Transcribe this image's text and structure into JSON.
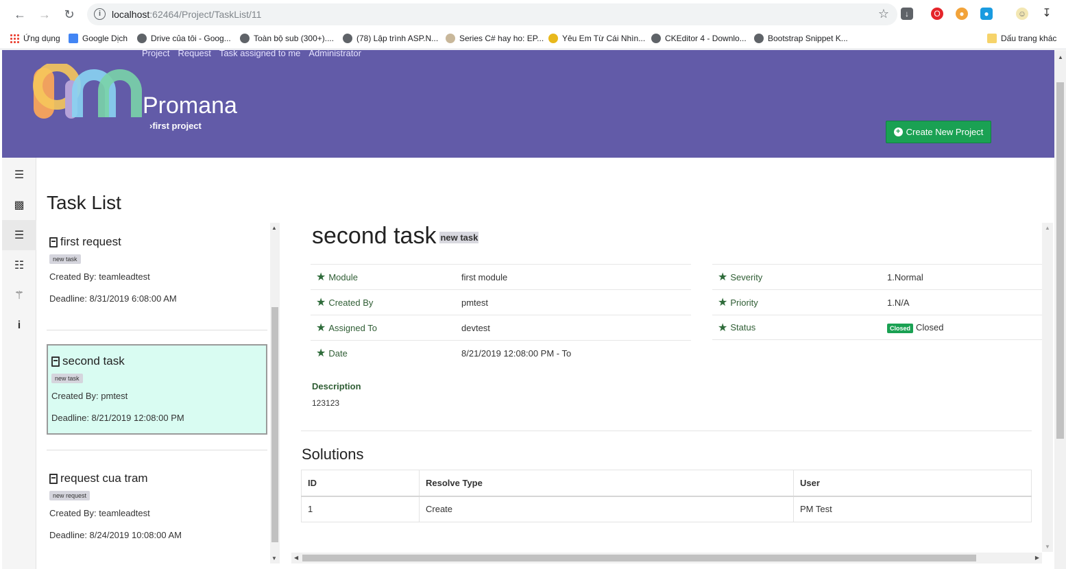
{
  "browser": {
    "url_host": "localhost",
    "url_path": ":62464/Project/TaskList/11",
    "bookmarks": [
      "Ứng dụng",
      "Google Dịch",
      "Drive của tôi - Goog...",
      "Toàn bộ sub (300+)....",
      "(78) Lập trình ASP.N...",
      "Series C# hay ho: EP...",
      "Yêu Em Từ Cái Nhìn...",
      "CKEditor 4 - Downlo...",
      "Bootstrap Snippet K...",
      "Dấu trang khác"
    ]
  },
  "header": {
    "nav": [
      "Project",
      "Request",
      "Task assigned to me",
      "Administrator"
    ],
    "brand": "Promana",
    "breadcrumb": "first project",
    "create_button": "Create New Project",
    "colors": {
      "header_bg": "#625ba8",
      "create_btn": "#1aa153"
    }
  },
  "sidebar": {
    "icons": [
      "menu-icon",
      "area-chart-icon",
      "task-list-icon",
      "cable-car-icon",
      "sitemap-icon",
      "info-icon"
    ]
  },
  "page": {
    "title": "Task List"
  },
  "task_list": [
    {
      "title": "first request",
      "badge": "new task",
      "created_by": "Created By: teamleadtest",
      "deadline": "Deadline: 8/31/2019 6:08:00 AM",
      "selected": false
    },
    {
      "title": "second task",
      "badge": "new task",
      "created_by": "Created By: pmtest",
      "deadline": "Deadline: 8/21/2019 12:08:00 PM",
      "selected": true
    },
    {
      "title": "request cua tram",
      "badge": "new request",
      "created_by": "Created By: teamleadtest",
      "deadline": "Deadline: 8/24/2019 10:08:00 AM",
      "selected": false
    }
  ],
  "detail": {
    "title": "second task",
    "tag": "new task",
    "left_fields": [
      {
        "label": "Module",
        "value": "first module"
      },
      {
        "label": "Created By",
        "value": "pmtest"
      },
      {
        "label": "Assigned To",
        "value": "devtest"
      },
      {
        "label": "Date",
        "value": "8/21/2019 12:08:00 PM - To"
      }
    ],
    "right_fields": [
      {
        "label": "Severity",
        "value": "1.Normal"
      },
      {
        "label": "Priority",
        "value": "1.N/A"
      },
      {
        "label": "Status",
        "value": "Closed",
        "badge": "Closed"
      }
    ],
    "description_label": "Description",
    "description": "123123"
  },
  "solutions": {
    "title": "Solutions",
    "headers": [
      "ID",
      "Resolve Type",
      "User"
    ],
    "rows": [
      [
        "1",
        "Create",
        "PM Test"
      ]
    ]
  }
}
